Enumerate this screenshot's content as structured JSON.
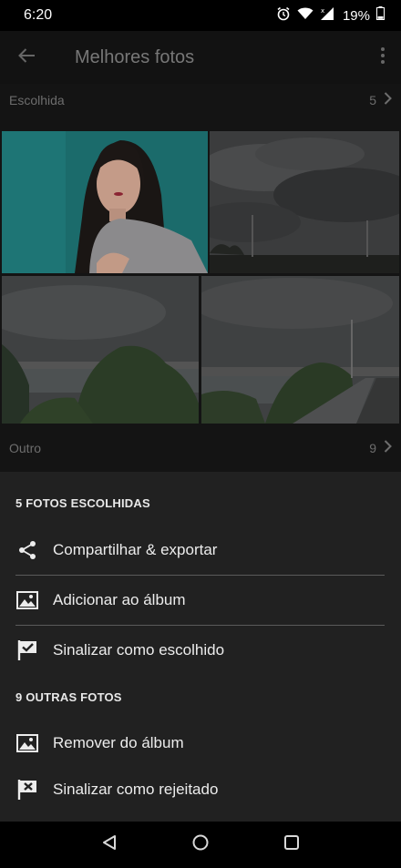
{
  "status": {
    "time": "6:20",
    "battery": "19%"
  },
  "app_bar": {
    "title": "Melhores fotos"
  },
  "section_picked": {
    "label": "Escolhida",
    "count": "5"
  },
  "section_other": {
    "label": "Outro",
    "count": "9"
  },
  "sheet": {
    "picked_heading": "5 FOTOS ESCOLHIDAS",
    "picked_items": [
      {
        "label": "Compartilhar & exportar",
        "icon": "share-icon"
      },
      {
        "label": "Adicionar ao álbum",
        "icon": "image-icon"
      },
      {
        "label": "Sinalizar como escolhido",
        "icon": "flag-check-icon"
      }
    ],
    "other_heading": "9 OUTRAS FOTOS",
    "other_items": [
      {
        "label": "Remover do álbum",
        "icon": "image-icon"
      },
      {
        "label": "Sinalizar como rejeitado",
        "icon": "flag-x-icon"
      }
    ]
  },
  "nav": {
    "icons": [
      "back-triangle-icon",
      "home-circle-icon",
      "recents-square-icon"
    ]
  },
  "colors": {
    "sheet_bg": "#212121",
    "dim_bg": "#141414",
    "text_dim": "#6d6d6d"
  }
}
